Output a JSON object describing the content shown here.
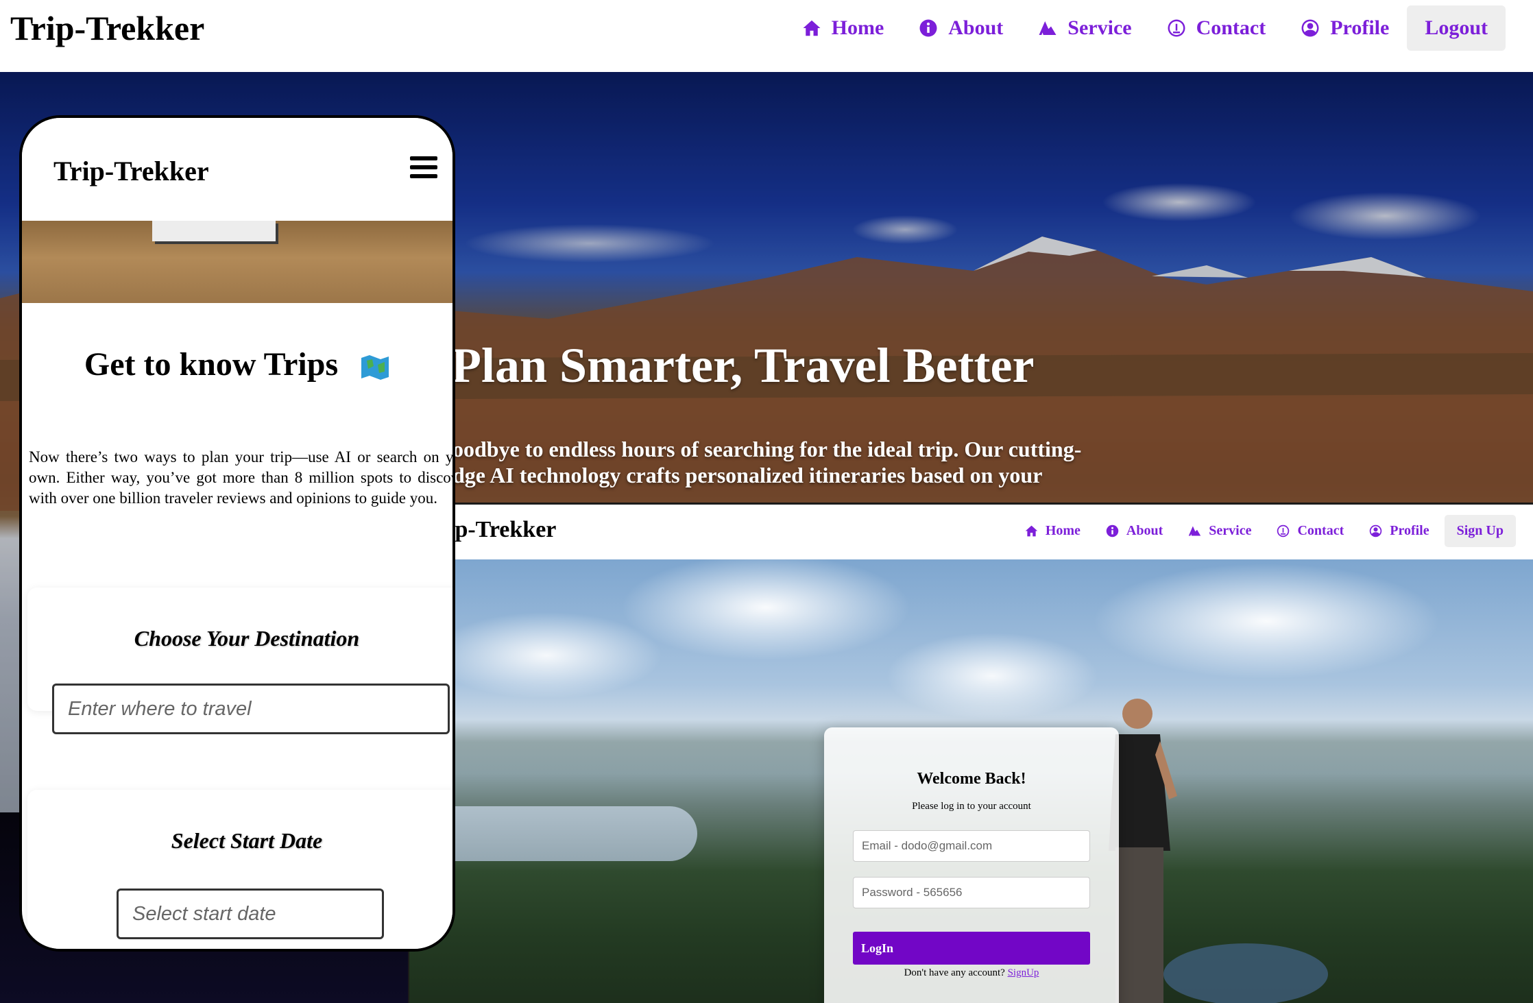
{
  "desktop": {
    "brand": "Trip-Trekker",
    "nav": [
      {
        "label": "Home",
        "icon": "home-icon"
      },
      {
        "label": "About",
        "icon": "info-icon"
      },
      {
        "label": "Service",
        "icon": "service-icon"
      },
      {
        "label": "Contact",
        "icon": "contact-icon"
      },
      {
        "label": "Profile",
        "icon": "profile-icon"
      }
    ],
    "logout_label": "Logout",
    "hero_title": "Plan Smarter, Travel Better",
    "hero_text": "oodbye to endless hours of searching for the ideal trip. Our cutting-dge AI technology crafts personalized itineraries based on your"
  },
  "login_page": {
    "brand": "ip-Trekker",
    "nav": [
      {
        "label": "Home",
        "icon": "home-icon"
      },
      {
        "label": "About",
        "icon": "info-icon"
      },
      {
        "label": "Service",
        "icon": "service-icon"
      },
      {
        "label": "Contact",
        "icon": "contact-icon"
      },
      {
        "label": "Profile",
        "icon": "profile-icon"
      }
    ],
    "signup_label": "Sign Up",
    "card": {
      "title": "Welcome Back!",
      "subtitle": "Please log in to your account",
      "email_placeholder": "Email - dodo@gmail.com",
      "password_placeholder": "Password - 565656",
      "login_label": "LogIn",
      "footer_text": "Don't have any account? ",
      "signup_link": "SignUp"
    }
  },
  "mobile": {
    "brand": "Trip-Trekker",
    "heading": "Get to know Trips",
    "heading_icon": "map-icon",
    "paragraph": "Now there’s two ways to plan your trip—use AI or search on your own. Either way, you’ve got more than 8 million spots to discover, with over one billion traveler reviews and opinions to guide you.",
    "destination_title": "Choose Your Destination",
    "destination_placeholder": "Enter where to travel",
    "start_date_title": "Select Start Date",
    "start_date_placeholder": "Select start date"
  },
  "colors": {
    "accent": "#7c1fd9",
    "login_button": "#7206c6"
  }
}
